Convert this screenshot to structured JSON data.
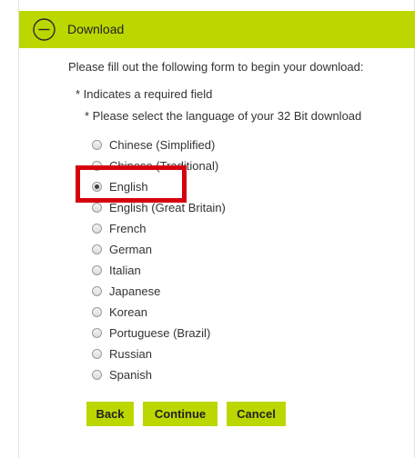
{
  "header": {
    "title": "Download",
    "icon": "minus-circle-icon",
    "accent_color": "#bcd700"
  },
  "form": {
    "intro": "Please fill out the following form to begin your download:",
    "required_note": "* Indicates a required field",
    "language_question": "* Please select the language of your 32 Bit download",
    "selected_language": "English",
    "languages": [
      {
        "label": "Chinese (Simplified)",
        "checked": false
      },
      {
        "label": "Chinese (Traditional)",
        "checked": false
      },
      {
        "label": "English",
        "checked": true
      },
      {
        "label": "English (Great Britain)",
        "checked": false
      },
      {
        "label": "French",
        "checked": false
      },
      {
        "label": "German",
        "checked": false
      },
      {
        "label": "Italian",
        "checked": false
      },
      {
        "label": "Japanese",
        "checked": false
      },
      {
        "label": "Korean",
        "checked": false
      },
      {
        "label": "Portuguese (Brazil)",
        "checked": false
      },
      {
        "label": "Russian",
        "checked": false
      },
      {
        "label": "Spanish",
        "checked": false
      }
    ]
  },
  "buttons": {
    "back": "Back",
    "continue": "Continue",
    "cancel": "Cancel"
  },
  "annotation": {
    "highlight_color": "#d7000f"
  }
}
